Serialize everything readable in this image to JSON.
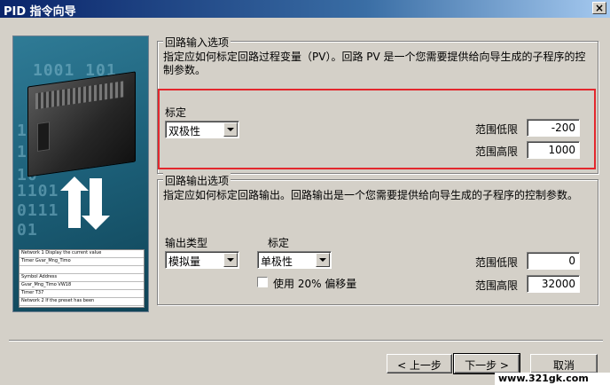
{
  "window": {
    "title": "PID 指令向导",
    "close_label": "×"
  },
  "illustration": {
    "binary_rows": [
      "1001 101",
      "10 01",
      "10",
      "10",
      "1101",
      "0111",
      "01"
    ],
    "ladder_rows": [
      "Network 1    Display the current value",
      "Timer     Gvar_Mng_Timo",
      "",
      "Symbol            Address",
      "Gvar_Mng_Timo     VW18",
      "Timer             T37",
      "Network 2    If the preset has been"
    ]
  },
  "loop_input": {
    "title": "回路输入选项",
    "description": "指定应如何标定回路过程变量（PV）。回路 PV 是一个您需要提供给向导生成的子程序的控制参数。",
    "scaling_label": "标定",
    "scaling_value": "双极性",
    "low_label": "范围低限",
    "low_value": "-200",
    "high_label": "范围高限",
    "high_value": "1000",
    "highlight_color": "#e3272d"
  },
  "loop_output": {
    "title": "回路输出选项",
    "description": "指定应如何标定回路输出。回路输出是一个您需要提供给向导生成的子程序的控制参数。",
    "output_type_label": "输出类型",
    "output_type_value": "模拟量",
    "scaling_label": "标定",
    "scaling_value": "单极性",
    "offset_checkbox_label": "使用 20% 偏移量",
    "low_label": "范围低限",
    "low_value": "0",
    "high_label": "范围高限",
    "high_value": "32000"
  },
  "buttons": {
    "prev": "< 上一步",
    "next": "下一步 >",
    "cancel": "取消"
  },
  "watermark": "www.321gk.com"
}
